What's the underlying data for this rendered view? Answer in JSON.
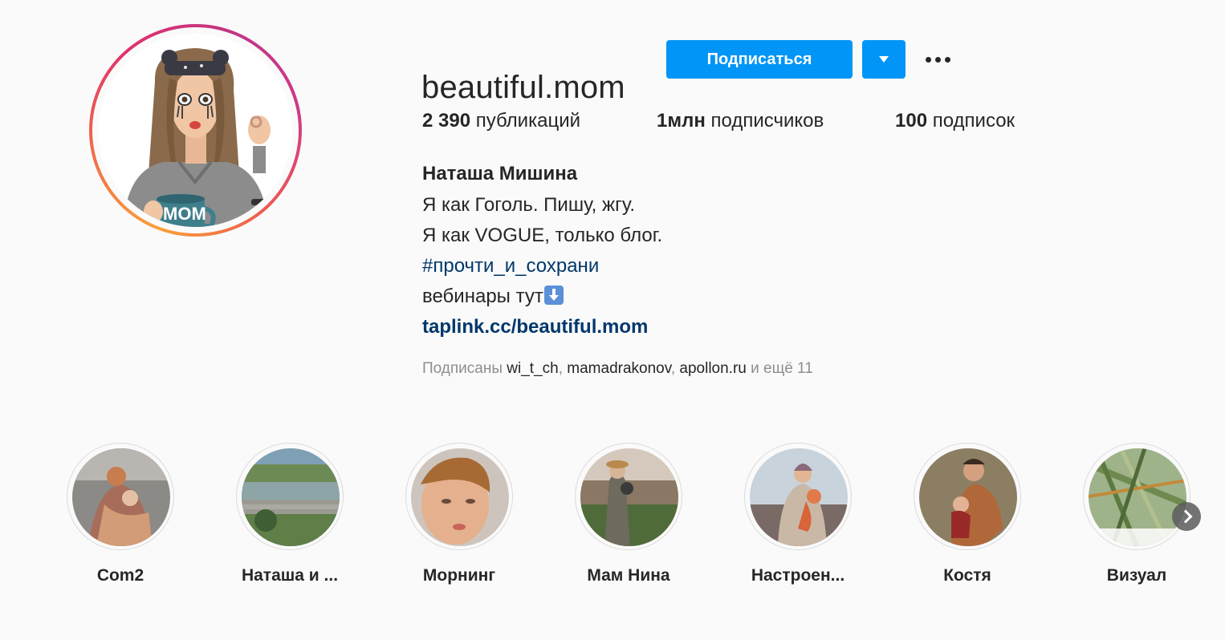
{
  "profile": {
    "username": "beautiful.mom",
    "avatar_icon": "cartoon-mom-avatar",
    "follow_label": "Подписаться",
    "dropdown_icon": "caret-down-icon",
    "more_icon": "more-horizontal-icon"
  },
  "stats": {
    "posts_count": "2 390",
    "posts_label": "публикаций",
    "followers_count": "1млн",
    "followers_label": "подписчиков",
    "following_count": "100",
    "following_label": "подписок"
  },
  "bio": {
    "name": "Наташа Мишина",
    "line1": "Я как Гоголь. Пишу, жгу.",
    "line2": "Я как VOGUE, только блог.",
    "hashtag": "#прочти_и_сохрани",
    "line4": "вебинары тут",
    "line4_emoji": "down-arrow-emoji",
    "link": "taplink.cc/beautiful.mom"
  },
  "followed_by": {
    "prefix": "Подписаны",
    "accounts": [
      "wi_t_ch",
      "mamadrakonov",
      "apollon.ru"
    ],
    "separator": ",",
    "suffix": "и ещё 11"
  },
  "highlights": [
    {
      "label": "Com2"
    },
    {
      "label": "Наташа и ..."
    },
    {
      "label": "Морнинг"
    },
    {
      "label": "Мам Нина"
    },
    {
      "label": "Настроен..."
    },
    {
      "label": "Костя"
    },
    {
      "label": "Визуал"
    }
  ],
  "highlights_next_icon": "chevron-right-icon",
  "colors": {
    "primary_button": "#0095f6",
    "link": "#00376b",
    "secondary_text": "#8e8e8e",
    "text": "#262626"
  }
}
